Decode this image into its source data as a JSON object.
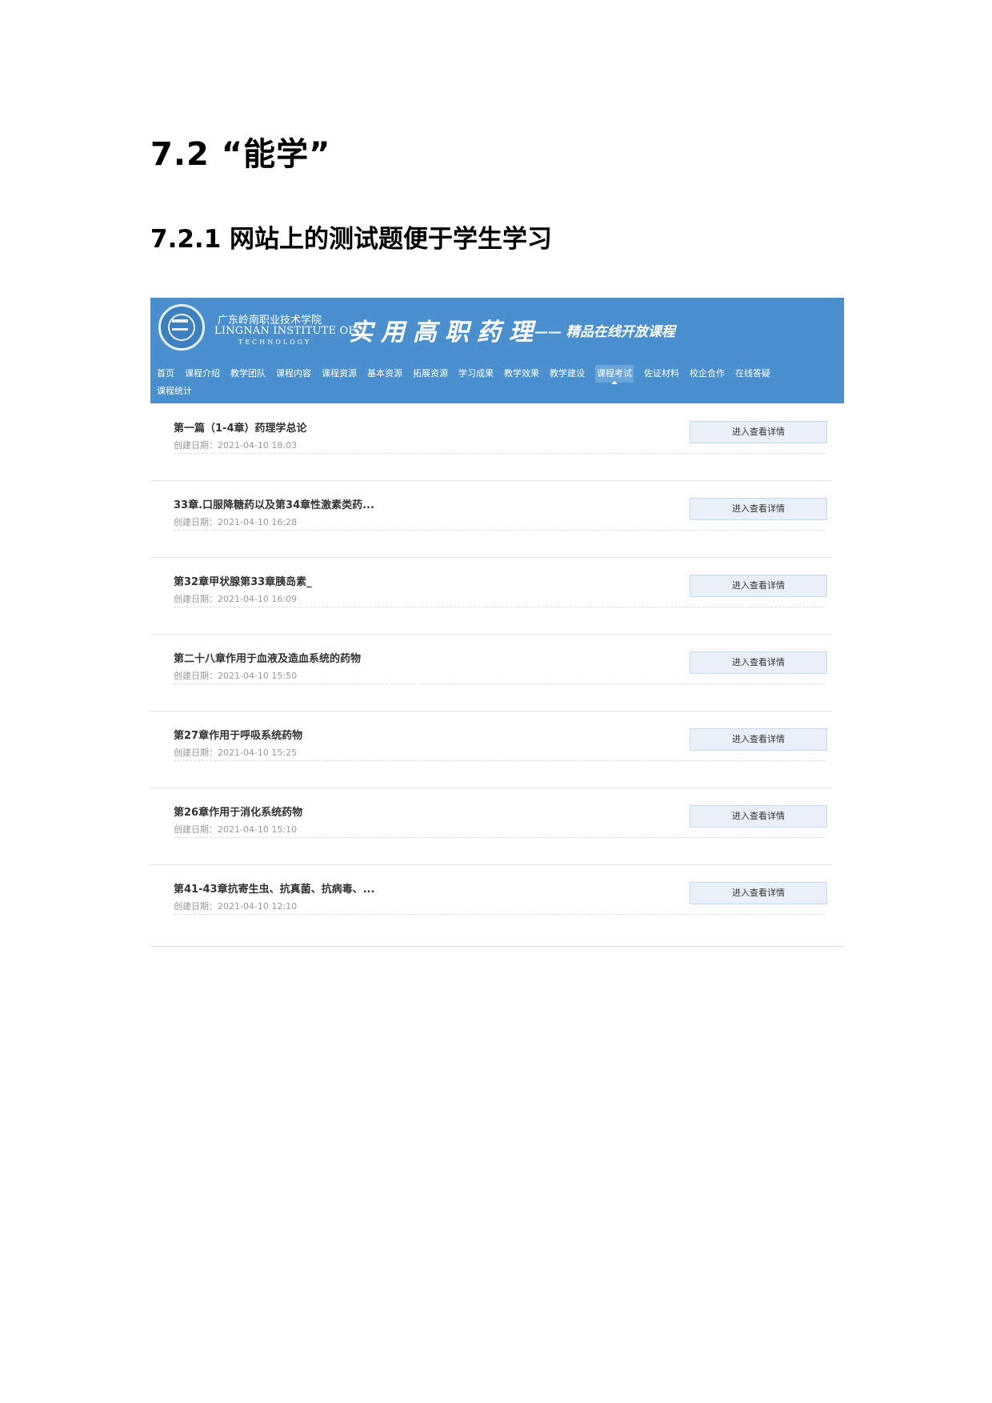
{
  "heading": "7.2 “能学”",
  "subheading": "7.2.1 网站上的测试题便于学生学习",
  "site": {
    "logo_cn": "广东岭南职业技术学院",
    "logo_en": "LINGNAN INSTITUTE OF",
    "logo_en2": "TECHNOLOGY",
    "course_title": "实用高职药理",
    "course_subtitle": "—— 精品在线开放课程",
    "nav": [
      "首页",
      "课程介绍",
      "教学团队",
      "课程内容",
      "课程资源",
      "基本资源",
      "拓展资源",
      "学习成果",
      "教学效果",
      "教学建设",
      "课程考试",
      "佐证材料",
      "校企合作",
      "在线答疑",
      "课程统计"
    ],
    "nav_active": "课程考试",
    "items": [
      {
        "title": "第一篇（1-4章）药理学总论",
        "date": "创建日期：2021-04-10 18:03",
        "button": "进入查看详情"
      },
      {
        "title": "33章.口服降糖药以及第34章性激素类药...",
        "date": "创建日期：2021-04-10 16:28",
        "button": "进入查看详情"
      },
      {
        "title": "第32章甲状腺第33章胰岛素_",
        "date": "创建日期：2021-04-10 16:09",
        "button": "进入查看详情"
      },
      {
        "title": "第二十八章作用于血液及造血系统的药物",
        "date": "创建日期：2021-04-10 15:50",
        "button": "进入查看详情"
      },
      {
        "title": "第27章作用于呼吸系统药物",
        "date": "创建日期：2021-04-10 15:25",
        "button": "进入查看详情"
      },
      {
        "title": "第26章作用于消化系统药物",
        "date": "创建日期：2021-04-10 15:10",
        "button": "进入查看详情"
      },
      {
        "title": "第41-43章抗寄生虫、抗真菌、抗病毒、...",
        "date": "创建日期：2021-04-10 12:10",
        "button": "进入查看详情"
      }
    ]
  },
  "colors": {
    "banner": "#4a90cf",
    "button_bg": "#e8f1f9"
  }
}
